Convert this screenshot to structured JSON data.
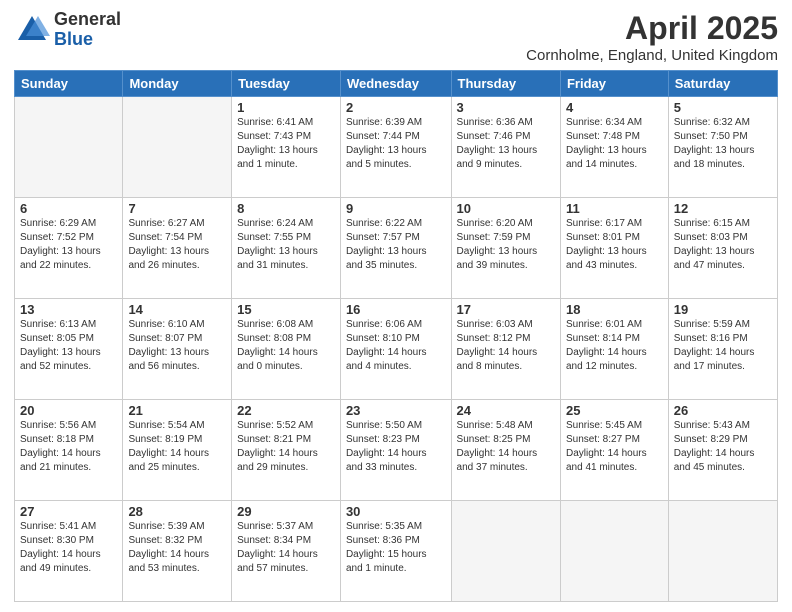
{
  "logo": {
    "general": "General",
    "blue": "Blue"
  },
  "header": {
    "title": "April 2025",
    "subtitle": "Cornholme, England, United Kingdom"
  },
  "weekdays": [
    "Sunday",
    "Monday",
    "Tuesday",
    "Wednesday",
    "Thursday",
    "Friday",
    "Saturday"
  ],
  "weeks": [
    [
      {
        "day": "",
        "info": ""
      },
      {
        "day": "",
        "info": ""
      },
      {
        "day": "1",
        "info": "Sunrise: 6:41 AM\nSunset: 7:43 PM\nDaylight: 13 hours and 1 minute."
      },
      {
        "day": "2",
        "info": "Sunrise: 6:39 AM\nSunset: 7:44 PM\nDaylight: 13 hours and 5 minutes."
      },
      {
        "day": "3",
        "info": "Sunrise: 6:36 AM\nSunset: 7:46 PM\nDaylight: 13 hours and 9 minutes."
      },
      {
        "day": "4",
        "info": "Sunrise: 6:34 AM\nSunset: 7:48 PM\nDaylight: 13 hours and 14 minutes."
      },
      {
        "day": "5",
        "info": "Sunrise: 6:32 AM\nSunset: 7:50 PM\nDaylight: 13 hours and 18 minutes."
      }
    ],
    [
      {
        "day": "6",
        "info": "Sunrise: 6:29 AM\nSunset: 7:52 PM\nDaylight: 13 hours and 22 minutes."
      },
      {
        "day": "7",
        "info": "Sunrise: 6:27 AM\nSunset: 7:54 PM\nDaylight: 13 hours and 26 minutes."
      },
      {
        "day": "8",
        "info": "Sunrise: 6:24 AM\nSunset: 7:55 PM\nDaylight: 13 hours and 31 minutes."
      },
      {
        "day": "9",
        "info": "Sunrise: 6:22 AM\nSunset: 7:57 PM\nDaylight: 13 hours and 35 minutes."
      },
      {
        "day": "10",
        "info": "Sunrise: 6:20 AM\nSunset: 7:59 PM\nDaylight: 13 hours and 39 minutes."
      },
      {
        "day": "11",
        "info": "Sunrise: 6:17 AM\nSunset: 8:01 PM\nDaylight: 13 hours and 43 minutes."
      },
      {
        "day": "12",
        "info": "Sunrise: 6:15 AM\nSunset: 8:03 PM\nDaylight: 13 hours and 47 minutes."
      }
    ],
    [
      {
        "day": "13",
        "info": "Sunrise: 6:13 AM\nSunset: 8:05 PM\nDaylight: 13 hours and 52 minutes."
      },
      {
        "day": "14",
        "info": "Sunrise: 6:10 AM\nSunset: 8:07 PM\nDaylight: 13 hours and 56 minutes."
      },
      {
        "day": "15",
        "info": "Sunrise: 6:08 AM\nSunset: 8:08 PM\nDaylight: 14 hours and 0 minutes."
      },
      {
        "day": "16",
        "info": "Sunrise: 6:06 AM\nSunset: 8:10 PM\nDaylight: 14 hours and 4 minutes."
      },
      {
        "day": "17",
        "info": "Sunrise: 6:03 AM\nSunset: 8:12 PM\nDaylight: 14 hours and 8 minutes."
      },
      {
        "day": "18",
        "info": "Sunrise: 6:01 AM\nSunset: 8:14 PM\nDaylight: 14 hours and 12 minutes."
      },
      {
        "day": "19",
        "info": "Sunrise: 5:59 AM\nSunset: 8:16 PM\nDaylight: 14 hours and 17 minutes."
      }
    ],
    [
      {
        "day": "20",
        "info": "Sunrise: 5:56 AM\nSunset: 8:18 PM\nDaylight: 14 hours and 21 minutes."
      },
      {
        "day": "21",
        "info": "Sunrise: 5:54 AM\nSunset: 8:19 PM\nDaylight: 14 hours and 25 minutes."
      },
      {
        "day": "22",
        "info": "Sunrise: 5:52 AM\nSunset: 8:21 PM\nDaylight: 14 hours and 29 minutes."
      },
      {
        "day": "23",
        "info": "Sunrise: 5:50 AM\nSunset: 8:23 PM\nDaylight: 14 hours and 33 minutes."
      },
      {
        "day": "24",
        "info": "Sunrise: 5:48 AM\nSunset: 8:25 PM\nDaylight: 14 hours and 37 minutes."
      },
      {
        "day": "25",
        "info": "Sunrise: 5:45 AM\nSunset: 8:27 PM\nDaylight: 14 hours and 41 minutes."
      },
      {
        "day": "26",
        "info": "Sunrise: 5:43 AM\nSunset: 8:29 PM\nDaylight: 14 hours and 45 minutes."
      }
    ],
    [
      {
        "day": "27",
        "info": "Sunrise: 5:41 AM\nSunset: 8:30 PM\nDaylight: 14 hours and 49 minutes."
      },
      {
        "day": "28",
        "info": "Sunrise: 5:39 AM\nSunset: 8:32 PM\nDaylight: 14 hours and 53 minutes."
      },
      {
        "day": "29",
        "info": "Sunrise: 5:37 AM\nSunset: 8:34 PM\nDaylight: 14 hours and 57 minutes."
      },
      {
        "day": "30",
        "info": "Sunrise: 5:35 AM\nSunset: 8:36 PM\nDaylight: 15 hours and 1 minute."
      },
      {
        "day": "",
        "info": ""
      },
      {
        "day": "",
        "info": ""
      },
      {
        "day": "",
        "info": ""
      }
    ]
  ]
}
